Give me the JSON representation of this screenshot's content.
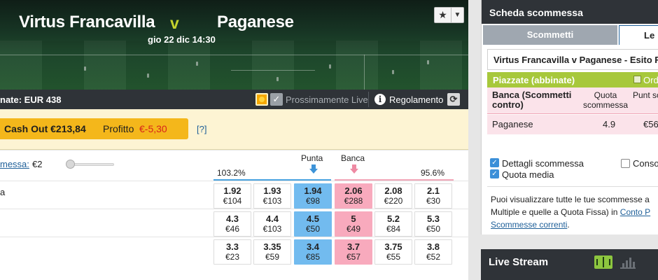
{
  "event": {
    "home_team": "Virtus Francavilla",
    "versus": "v",
    "away_team": "Paganese",
    "datetime": "gio 22 dic 14:30",
    "favorite_icon": "star-icon"
  },
  "info_bar": {
    "matched": "nate: EUR 438",
    "soon_live": "Prossimamente Live",
    "rules": "Regolamento",
    "icons": [
      "sun-icon",
      "check-icon",
      "info-icon",
      "refresh-icon"
    ]
  },
  "cashout": {
    "label": "Cash Out €213,84",
    "profit_label": "Profitto",
    "profit_value": "€-5,30",
    "help": "[?]"
  },
  "market": {
    "stake_label": "messa:",
    "stake_value": "€2",
    "book_back": "103.2%",
    "book_lay": "95.6%",
    "back_label": "Punta",
    "lay_label": "Banca",
    "runners": [
      {
        "name": "a",
        "cells": [
          {
            "odd": "1.92",
            "vol": "€104"
          },
          {
            "odd": "1.93",
            "vol": "€103"
          },
          {
            "odd": "1.94",
            "vol": "€98"
          },
          {
            "odd": "2.06",
            "vol": "€288"
          },
          {
            "odd": "2.08",
            "vol": "€220"
          },
          {
            "odd": "2.1",
            "vol": "€30"
          }
        ]
      },
      {
        "name": "",
        "cells": [
          {
            "odd": "4.3",
            "vol": "€46"
          },
          {
            "odd": "4.4",
            "vol": "€103"
          },
          {
            "odd": "4.5",
            "vol": "€50"
          },
          {
            "odd": "5",
            "vol": "€49"
          },
          {
            "odd": "5.2",
            "vol": "€84"
          },
          {
            "odd": "5.3",
            "vol": "€50"
          }
        ]
      },
      {
        "name": "",
        "cells": [
          {
            "odd": "3.3",
            "vol": "€23"
          },
          {
            "odd": "3.35",
            "vol": "€59"
          },
          {
            "odd": "3.4",
            "vol": "€85"
          },
          {
            "odd": "3.7",
            "vol": "€57"
          },
          {
            "odd": "3.75",
            "vol": "€55"
          },
          {
            "odd": "3.8",
            "vol": "€52"
          }
        ]
      }
    ]
  },
  "betslip": {
    "title": "Scheda scommessa",
    "tab_bets": "Scommetti",
    "tab_mine": "Le",
    "market_name": "Virtus Francavilla v Paganese - Esito F",
    "placed_label": "Piazzate (abbinate)",
    "order_label": "Ord",
    "lay_header": "Banca (Scommetti contro)",
    "odds_header": "Quota scommessa",
    "stake_header": "Punt scom",
    "lay_runner": "Paganese",
    "lay_odds": "4.9",
    "lay_stake": "€56",
    "opt_details": "Dettagli scommessa",
    "opt_average": "Quota media",
    "opt_consol": "Consol",
    "note_line1": "Puoi visualizzare tutte le tue scommesse a",
    "note_line2": "Multiple e quelle a Quota Fissa) in",
    "note_link1": "Conto P",
    "note_link2": "Scommesse correnti",
    "note_end": "."
  },
  "live_stream": {
    "title": "Live Stream",
    "icons": [
      "pitch-icon",
      "stats-icon"
    ]
  },
  "colors": {
    "back": "#72bbef",
    "lay": "#f8aabd",
    "cashout": "#f4b71b",
    "accent_green": "#a7c83b",
    "header_dark": "#2f3338"
  }
}
